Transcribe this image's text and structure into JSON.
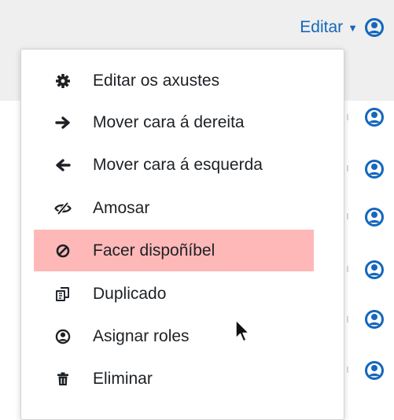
{
  "header": {
    "editar_label": "Editar",
    "caret_icon": "caret-down-icon",
    "user_icon": "user-circle-icon"
  },
  "menu": {
    "items": [
      {
        "label": "Editar os axustes",
        "icon": "gear-icon"
      },
      {
        "label": "Mover cara á dereita",
        "icon": "arrow-right-icon"
      },
      {
        "label": "Mover cara á esquerda",
        "icon": "arrow-left-icon"
      },
      {
        "label": "Amosar",
        "icon": "eye-slash-icon"
      },
      {
        "label": "Facer dispoñíbel",
        "icon": "ban-icon",
        "highlighted": true
      },
      {
        "label": "Duplicado",
        "icon": "copy-icon"
      },
      {
        "label": "Asignar roles",
        "icon": "user-circle-icon"
      },
      {
        "label": "Eliminar",
        "icon": "trash-icon"
      }
    ]
  },
  "colors": {
    "link_blue": "#1467bc",
    "highlight": "#ffb8b8",
    "text": "#1d2125",
    "top_band": "#efefef"
  }
}
